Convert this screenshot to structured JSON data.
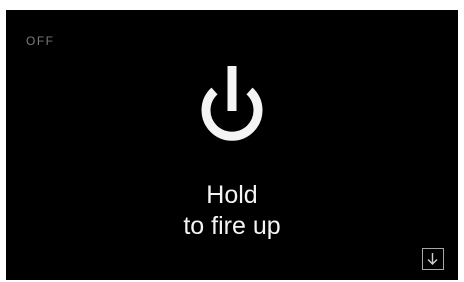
{
  "status": {
    "label": "OFF"
  },
  "power": {
    "icon": "power-icon",
    "prompt_line1": "Hold",
    "prompt_line2": "to fire up"
  },
  "footer": {
    "down_icon": "arrow-down-icon"
  },
  "colors": {
    "background": "#000000",
    "foreground": "#f4f4f4",
    "muted": "#7a7a7a"
  }
}
